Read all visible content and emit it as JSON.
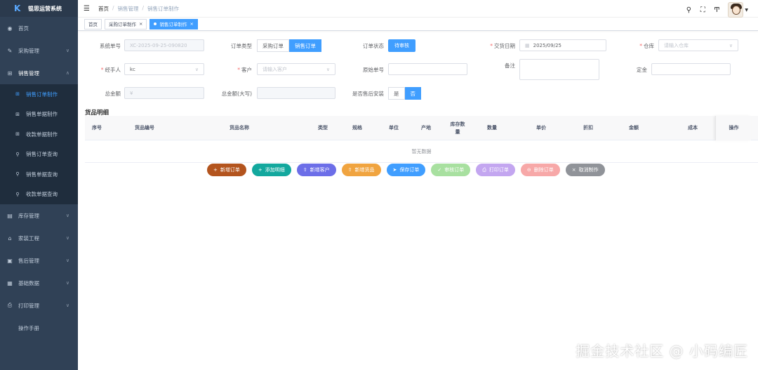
{
  "app": {
    "logo_mark": "K",
    "title": "锟思运营系统"
  },
  "sidebar": {
    "items": [
      {
        "icon": "◉",
        "label": "首页"
      },
      {
        "icon": "✎",
        "label": "采购管理"
      },
      {
        "icon": "⊞",
        "label": "销售管理"
      },
      {
        "icon": "▤",
        "label": "库存管理"
      },
      {
        "icon": "⌂",
        "label": "家装工程"
      },
      {
        "icon": "▣",
        "label": "售后管理"
      },
      {
        "icon": "▦",
        "label": "基础数据"
      },
      {
        "icon": "⎙",
        "label": "打印管理"
      },
      {
        "icon": "",
        "label": "操作手册"
      }
    ],
    "sales_sub": [
      {
        "icon": "⊞",
        "label": "销售订单制作"
      },
      {
        "icon": "⊞",
        "label": "销售单据制作"
      },
      {
        "icon": "⊞",
        "label": "收款单据制作"
      },
      {
        "icon": "⚲",
        "label": "销售订单查询"
      },
      {
        "icon": "⚲",
        "label": "销售单据查询"
      },
      {
        "icon": "⚲",
        "label": "收款单据查询"
      }
    ]
  },
  "navbar": {
    "breadcrumb": [
      "首页",
      "销售管理",
      "销售订单制作"
    ],
    "sep": "/"
  },
  "tags": [
    "首页",
    "采购订单制作",
    "销售订单制作"
  ],
  "form": {
    "sys_no_label": "系统单号",
    "sys_no": "XC-2025-09-25-090820",
    "order_type_label": "订单类型",
    "order_type_opts": [
      "采购订单",
      "销售订单"
    ],
    "order_status_label": "订单状态",
    "order_status": "待审核",
    "deal_date_label": "交货日期",
    "deal_date": "2025/09/25",
    "warehouse_label": "仓库",
    "warehouse_ph": "请输入仓库",
    "handler_label": "经手人",
    "handler": "kc",
    "customer_label": "客户",
    "customer_ph": "请输入客户",
    "orig_no_label": "原始单号",
    "remark_label": "备注",
    "deposit_label": "定金",
    "total_label": "总金额",
    "total_prefix": "¥",
    "total_cn_label": "总金额(大写)",
    "after_sale_label": "是否售后安装",
    "after_sale_opts": [
      "是",
      "否"
    ]
  },
  "table": {
    "title": "货品明细",
    "headers": [
      "序号",
      "货品编号",
      "货品名称",
      "类型",
      "规格",
      "单位",
      "产地",
      "库存数\n量",
      "数量",
      "单价",
      "折扣",
      "金额",
      "成本",
      "操作"
    ],
    "empty": "暂无数据"
  },
  "actions": [
    {
      "icon": "+",
      "label": "新增订单",
      "color": "#b3541e"
    },
    {
      "icon": "+",
      "label": "添加明细",
      "color": "#13a89e"
    },
    {
      "icon": "⇧",
      "label": "新增客户",
      "color": "#6c6ee8"
    },
    {
      "icon": "⇧",
      "label": "新增货品",
      "color": "#f0a440"
    },
    {
      "icon": "➤",
      "label": "保存订单",
      "color": "#409eff"
    },
    {
      "icon": "✓",
      "label": "审核订单",
      "color": "#a8e0a0"
    },
    {
      "icon": "⎙",
      "label": "打印订单",
      "color": "#c3a6f0"
    },
    {
      "icon": "⊖",
      "label": "删除订单",
      "color": "#f7a8a8"
    },
    {
      "icon": "×",
      "label": "取消制作",
      "color": "#909399"
    }
  ],
  "watermark": "掘金技术社区 @ 小码编匠"
}
